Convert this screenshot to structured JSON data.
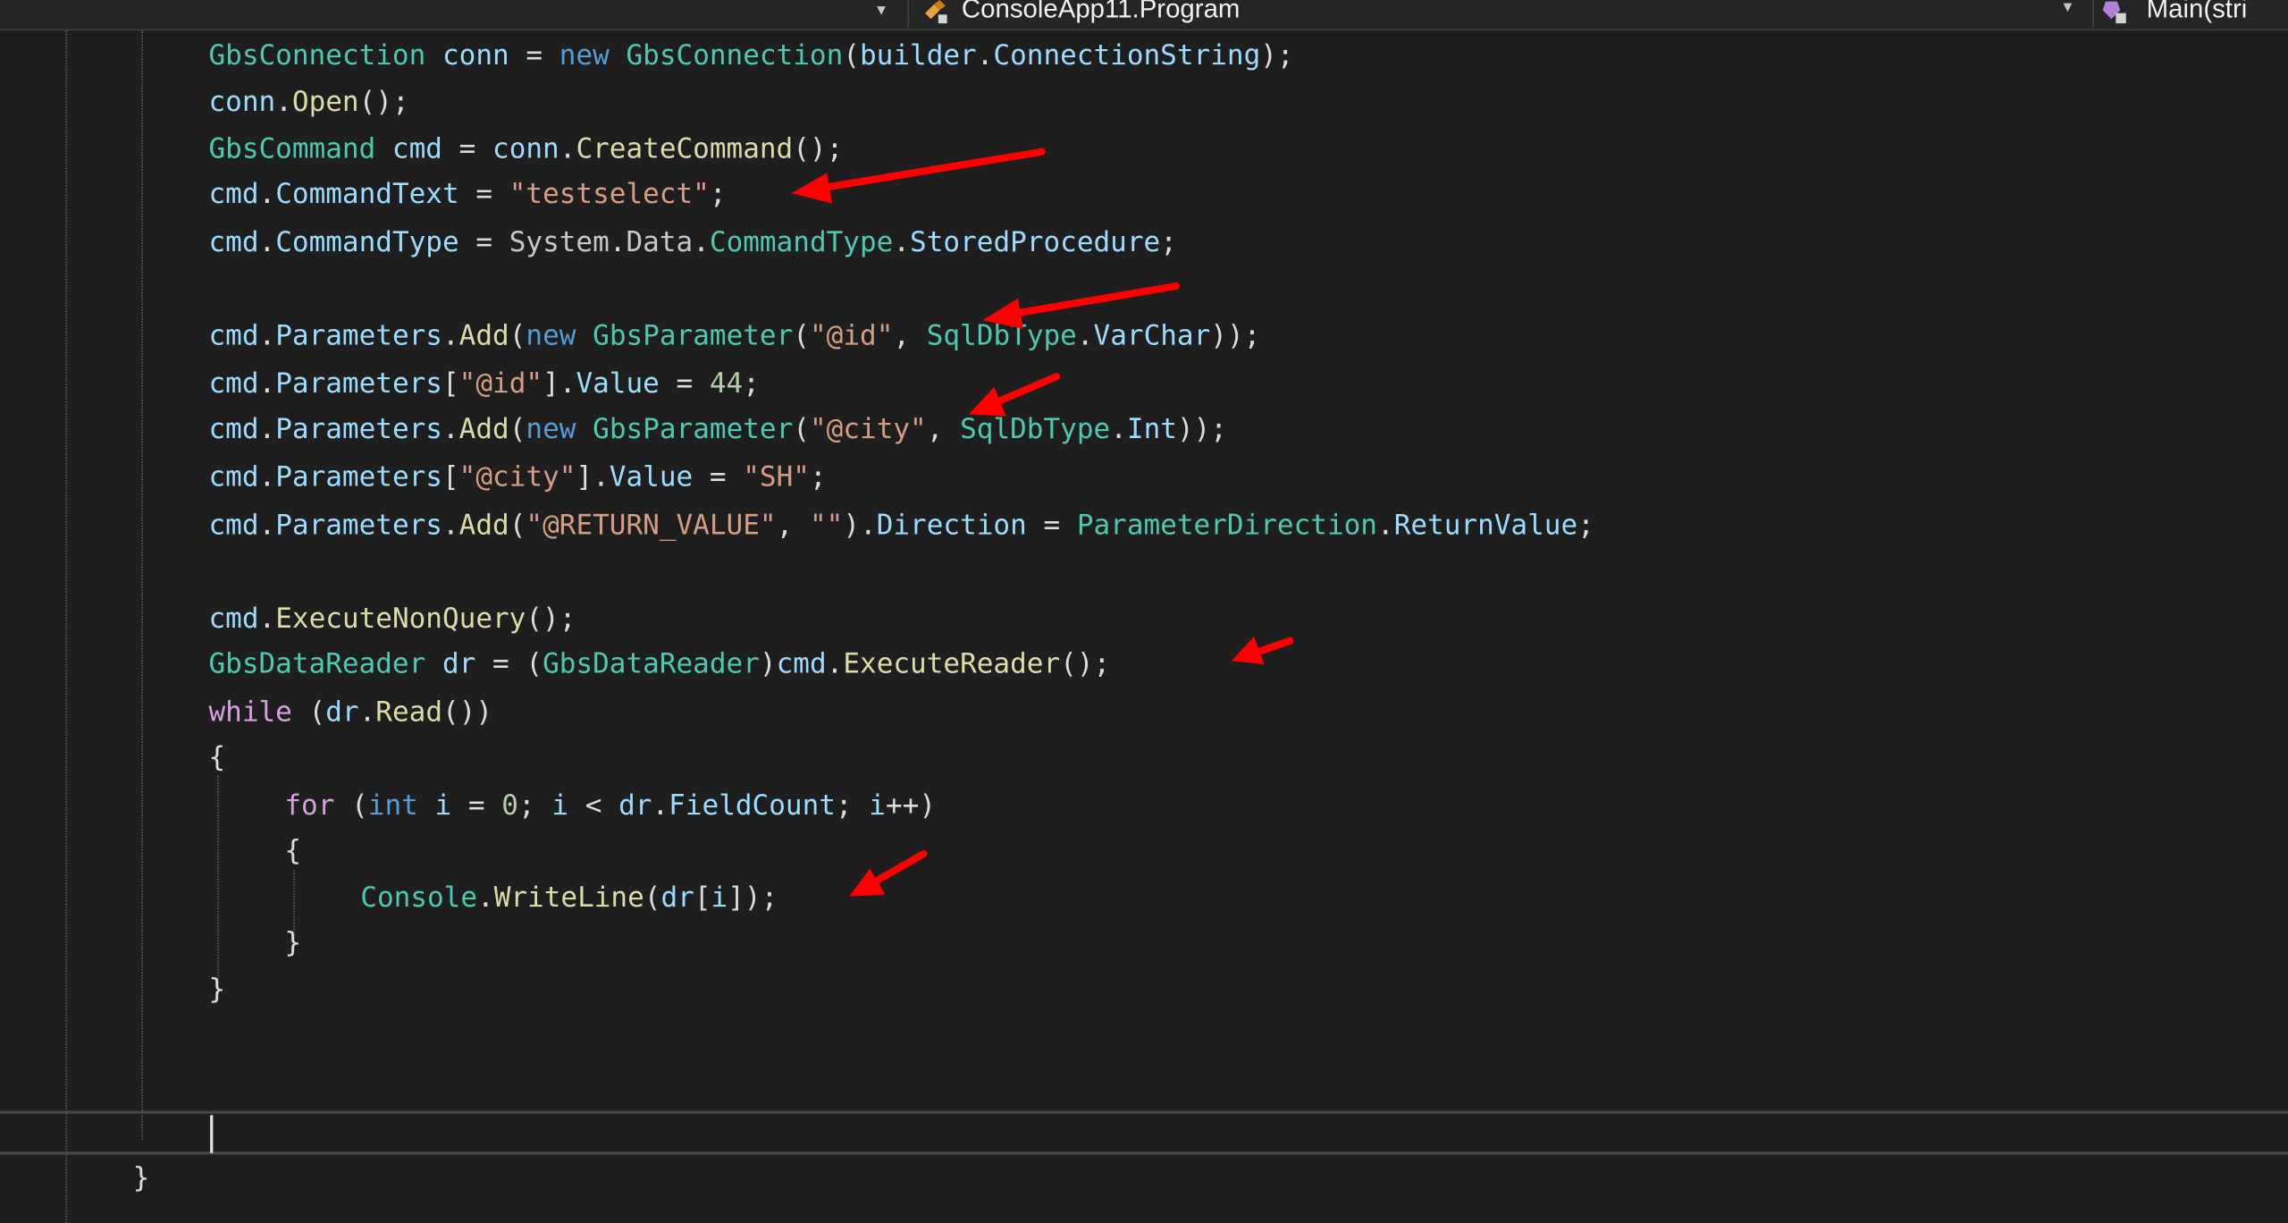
{
  "navbar": {
    "class_combo": "ConsoleApp11.Program",
    "member_combo": "Main(stri"
  },
  "code": {
    "line1": {
      "t1": "GbsConnection",
      "v1": "conn",
      "eq": " = ",
      "k1": "new",
      "t2": "GbsConnection",
      "p1": "(",
      "v2": "builder",
      "p2": ".",
      "v3": "ConnectionString",
      "p3": ");"
    },
    "line2": {
      "v1": "conn",
      "p1": ".",
      "m1": "Open",
      "p2": "();"
    },
    "line3": {
      "t1": "GbsCommand",
      "v1": "cmd",
      "eq": " = ",
      "v2": "conn",
      "p1": ".",
      "m1": "CreateCommand",
      "p2": "();"
    },
    "line4": {
      "v1": "cmd",
      "p1": ".",
      "v2": "CommandText",
      "eq": " = ",
      "s1": "\"testselect\"",
      "p2": ";"
    },
    "line5": {
      "v1": "cmd",
      "p1": ".",
      "v2": "CommandType",
      "eq": " = ",
      "x1": "System",
      "p2": ".",
      "x2": "Data",
      "p3": ".",
      "t1": "CommandType",
      "p4": ".",
      "v3": "StoredProcedure",
      "p5": ";"
    },
    "line6": {
      "v1": "cmd",
      "p1": ".",
      "v2": "Parameters",
      "p2": ".",
      "m1": "Add",
      "p3": "(",
      "k1": "new",
      "t1": "GbsParameter",
      "p4": "(",
      "s1": "\"@id\"",
      "p5": ", ",
      "t2": "SqlDbType",
      "p6": ".",
      "v3": "VarChar",
      "p7": "));"
    },
    "line7": {
      "v1": "cmd",
      "p1": ".",
      "v2": "Parameters",
      "p2": "[",
      "s1": "\"@id\"",
      "p3": "].",
      "v3": "Value",
      "eq": " = ",
      "n1": "44",
      "p4": ";"
    },
    "line8": {
      "v1": "cmd",
      "p1": ".",
      "v2": "Parameters",
      "p2": ".",
      "m1": "Add",
      "p3": "(",
      "k1": "new",
      "t1": "GbsParameter",
      "p4": "(",
      "s1": "\"@city\"",
      "p5": ", ",
      "t2": "SqlDbType",
      "p6": ".",
      "v3": "Int",
      "p7": "));"
    },
    "line9": {
      "v1": "cmd",
      "p1": ".",
      "v2": "Parameters",
      "p2": "[",
      "s1": "\"@city\"",
      "p3": "].",
      "v3": "Value",
      "eq": " = ",
      "s2": "\"SH\"",
      "p4": ";"
    },
    "line10": {
      "v1": "cmd",
      "p1": ".",
      "v2": "Parameters",
      "p2": ".",
      "m1": "Add",
      "p3": "(",
      "s1": "\"@RETURN_VALUE\"",
      "p4": ", ",
      "s2": "\"\"",
      "p5": ").",
      "v3": "Direction",
      "eq": " = ",
      "t1": "ParameterDirection",
      "p6": ".",
      "v4": "ReturnValue",
      "p7": ";"
    },
    "line11": {
      "v1": "cmd",
      "p1": ".",
      "m1": "ExecuteNonQuery",
      "p2": "();"
    },
    "line12": {
      "t1": "GbsDataReader",
      "v1": "dr",
      "eq": " = ",
      "p1": "(",
      "t2": "GbsDataReader",
      "p2": ")",
      "v2": "cmd",
      "p3": ".",
      "m1": "ExecuteReader",
      "p4": "();"
    },
    "line13": {
      "c1": "while",
      "p1": " (",
      "v1": "dr",
      "p2": ".",
      "m1": "Read",
      "p3": "())"
    },
    "line14": {
      "p1": "{"
    },
    "line15": {
      "c1": "for",
      "p1": " (",
      "k1": "int",
      "v1": "i",
      "eq": " = ",
      "n1": "0",
      "p2": "; ",
      "v2": "i",
      "p3": " < ",
      "v3": "dr",
      "p4": ".",
      "v4": "FieldCount",
      "p5": "; ",
      "v5": "i",
      "p6": "++)"
    },
    "line16": {
      "p1": "{"
    },
    "line17": {
      "t1": "Console",
      "p1": ".",
      "m1": "WriteLine",
      "p2": "(",
      "v1": "dr",
      "p3": "[",
      "v2": "i",
      "p4": "]);"
    },
    "line18": {
      "p1": "}"
    },
    "line19": {
      "p1": "}"
    },
    "line20": {
      "p1": "}"
    }
  },
  "colors": {
    "background": "#1e1e1e",
    "type": "#4ec9b0",
    "keyword": "#569cd6",
    "variable": "#9cdcfe",
    "method": "#dcdcaa",
    "string": "#d69d85",
    "number": "#b5cea8",
    "control": "#d8a0df",
    "annotation_arrow": "#ff0000"
  }
}
